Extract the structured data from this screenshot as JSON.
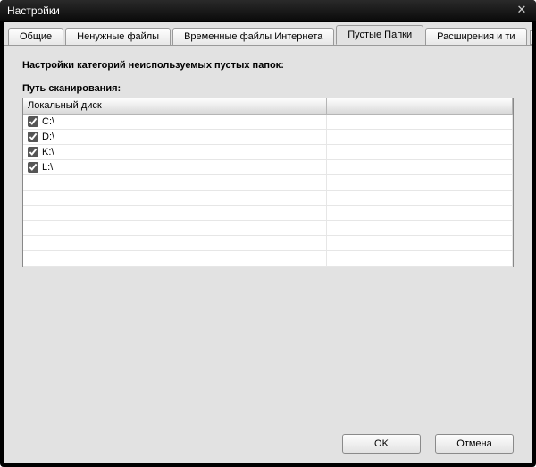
{
  "window": {
    "title": "Настройки"
  },
  "tabs": [
    {
      "label": "Общие",
      "active": false
    },
    {
      "label": "Ненужные файлы",
      "active": false
    },
    {
      "label": "Временные файлы Интернета",
      "active": false
    },
    {
      "label": "Пустые Папки",
      "active": true
    },
    {
      "label": "Расширения и ти",
      "active": false
    }
  ],
  "content": {
    "heading": "Настройки категорий неиспользуемых пустых папок:",
    "subheading": "Путь сканирования:"
  },
  "grid": {
    "header": {
      "col1": "Локальный диск",
      "col2": ""
    },
    "rows": [
      {
        "checked": true,
        "path": "C:\\"
      },
      {
        "checked": true,
        "path": "D:\\"
      },
      {
        "checked": true,
        "path": "K:\\"
      },
      {
        "checked": true,
        "path": "L:\\"
      }
    ],
    "emptyRows": 6
  },
  "buttons": {
    "ok": "OK",
    "cancel": "Отмена"
  }
}
